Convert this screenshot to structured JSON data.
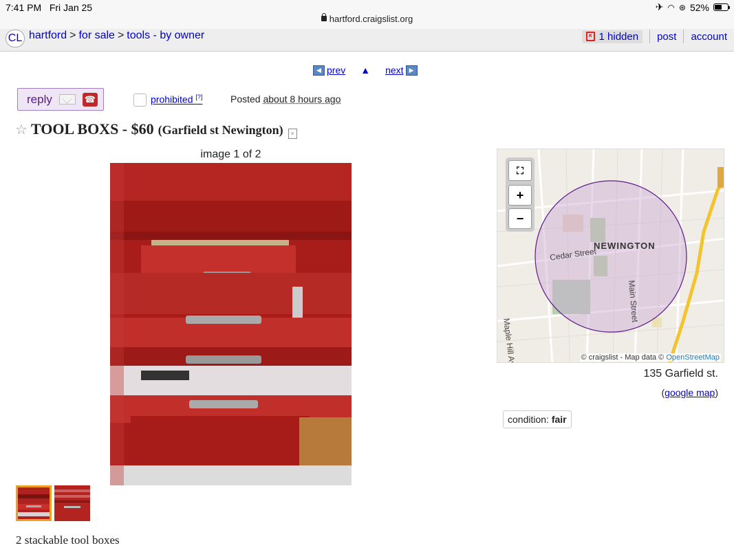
{
  "status_bar": {
    "time": "7:41 PM",
    "date": "Fri Jan 25",
    "battery": "52%",
    "url": "hartford.craigslist.org"
  },
  "header": {
    "logo": "CL",
    "breadcrumbs": [
      {
        "label": "hartford"
      },
      {
        "label": "for sale"
      },
      {
        "label": "tools - by owner"
      }
    ],
    "hidden_label": "1 hidden",
    "post_label": "post",
    "account_label": "account"
  },
  "pager": {
    "prev": "prev",
    "up": "▲",
    "next": "next"
  },
  "reply": {
    "label": "reply"
  },
  "prohibited": {
    "label": "prohibited",
    "help": "[?]"
  },
  "posted": {
    "prefix": "Posted",
    "ago": "about 8 hours ago"
  },
  "listing": {
    "title": "TOOL BOXS - $60",
    "location": "(Garfield st Newington)",
    "image_counter": "image 1 of 2",
    "description": "2 stackable tool boxes"
  },
  "map": {
    "town_label": "NEWINGTON",
    "street_cedar": "Cedar Street",
    "street_maple": "Maple Hill Avenue",
    "street_main": "Main Street",
    "credit_prefix": "© craigslist - Map data ©",
    "credit_osm": "OpenStreetMap",
    "zoom_in": "+",
    "zoom_out": "−"
  },
  "address": {
    "street": "135 Garfield st.",
    "google_map": "google map"
  },
  "attributes": {
    "condition_label": "condition:",
    "condition_value": "fair"
  },
  "colors": {
    "link": "#0000cc",
    "reply_bg": "#eee6f5",
    "toolbox_red": "#ae1f1c",
    "map_circle": "#5c1a8a"
  },
  "icons": [
    "lock-icon",
    "airplane-icon",
    "wifi-icon",
    "battery-icon",
    "hidden-x-icon",
    "envelope-icon",
    "phone-icon",
    "star-icon",
    "hide-posting-icon",
    "fullscreen-icon",
    "zoom-in-icon",
    "zoom-out-icon"
  ]
}
